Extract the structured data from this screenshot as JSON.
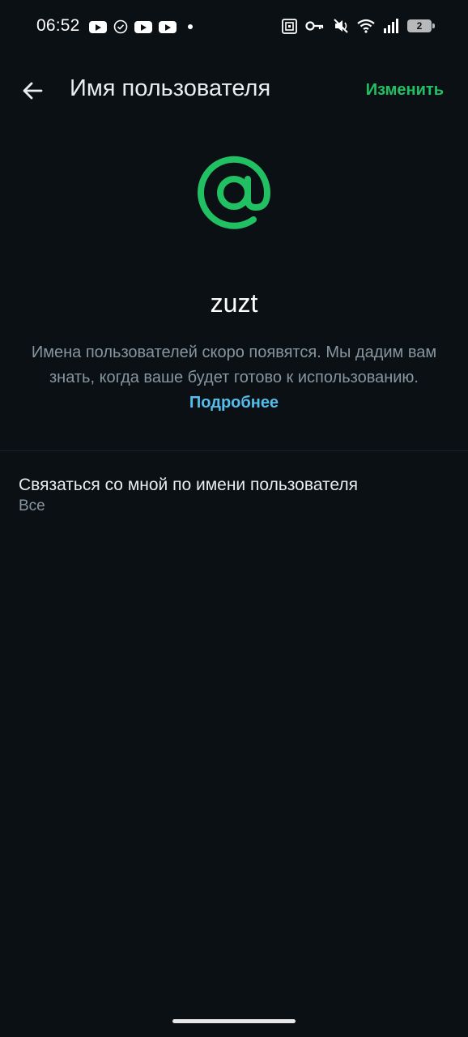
{
  "status_bar": {
    "time": "06:52",
    "battery_level": "2",
    "icons": [
      "youtube-icon",
      "check-circle-icon",
      "youtube-icon",
      "youtube-icon",
      "dot-icon",
      "nfc-icon",
      "key-icon",
      "mute-icon",
      "wifi-icon",
      "signal-icon",
      "battery-icon"
    ]
  },
  "app_bar": {
    "title": "Имя пользователя",
    "edit_label": "Изменить",
    "back_icon": "arrow-left-icon"
  },
  "profile": {
    "icon": "at-sign-icon",
    "username": "zuzt",
    "description": "Имена пользователей скоро появятся. Мы дадим вам знать, когда ваше будет готово к использованию.",
    "learn_more": "Подробнее"
  },
  "contact_setting": {
    "title": "Связаться со мной по имени пользователя",
    "value": "Все"
  },
  "colors": {
    "background": "#0b1014",
    "accent_green": "#21c063",
    "link_blue": "#53bdeb",
    "secondary_text": "#8696a0"
  }
}
